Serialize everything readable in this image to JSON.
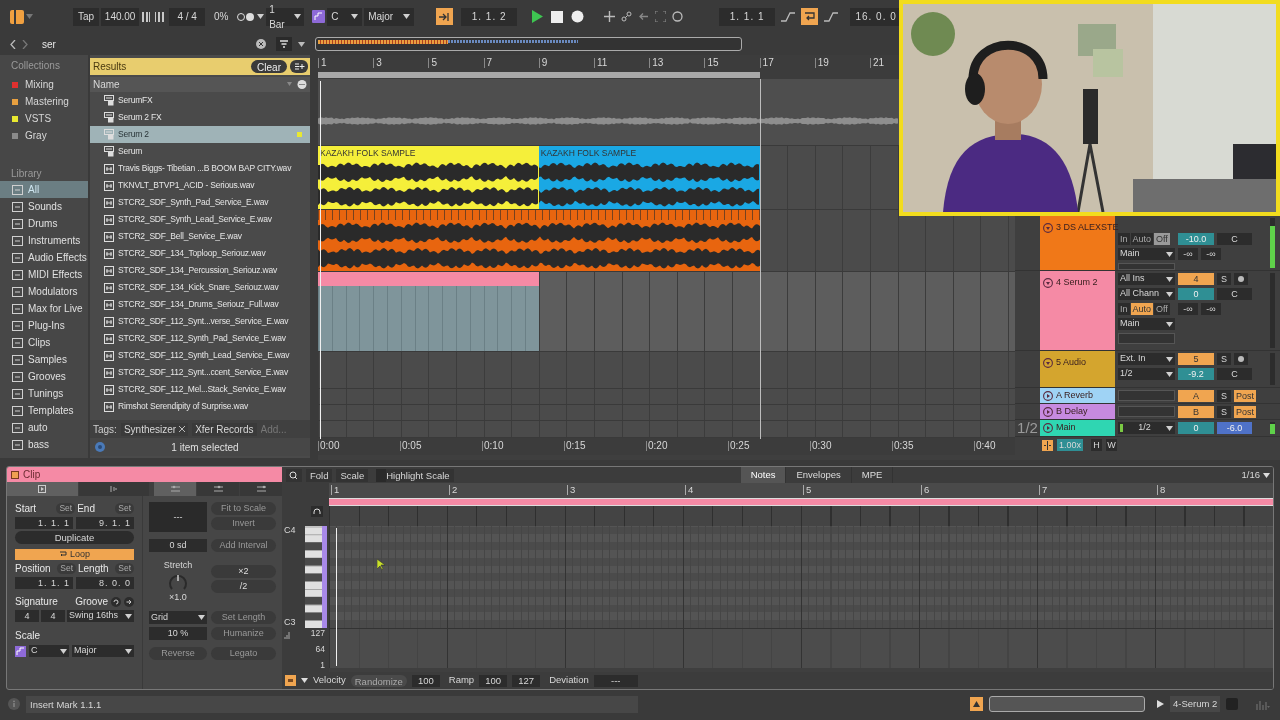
{
  "transport": {
    "tap": "Tap",
    "tempo": "140.00",
    "signature": "4 / 4",
    "cpu": "0%",
    "quantize": "1 Bar",
    "key": "C",
    "scale": "Major",
    "follow": true,
    "position": "1. 1. 2",
    "playing": true,
    "loop_start": "1. 1. 1",
    "loop": true,
    "loop_length": "16. 0. 0"
  },
  "browser": {
    "search": "ser",
    "collections_title": "Collections",
    "collections": [
      {
        "label": "Mixing",
        "color": "#e0302f"
      },
      {
        "label": "Mastering",
        "color": "#e8a040"
      },
      {
        "label": "VSTS",
        "color": "#e8e830"
      },
      {
        "label": "Gray",
        "color": "#8a8a8a"
      }
    ],
    "library_title": "Library",
    "library": [
      {
        "label": "All",
        "selected": true
      },
      {
        "label": "Sounds",
        "selected": false
      },
      {
        "label": "Drums",
        "selected": false
      },
      {
        "label": "Instruments",
        "selected": false
      },
      {
        "label": "Audio Effects",
        "selected": false
      },
      {
        "label": "MIDI Effects",
        "selected": false
      },
      {
        "label": "Modulators",
        "selected": false
      },
      {
        "label": "Max for Live",
        "selected": false
      },
      {
        "label": "Plug-Ins",
        "selected": false
      },
      {
        "label": "Clips",
        "selected": false
      },
      {
        "label": "Samples",
        "selected": false
      },
      {
        "label": "Grooves",
        "selected": false
      },
      {
        "label": "Tunings",
        "selected": false
      },
      {
        "label": "Templates",
        "selected": false
      },
      {
        "label": "auto",
        "selected": false
      },
      {
        "label": "bass",
        "selected": false
      }
    ],
    "results_title": "Results",
    "clear": "Clear",
    "column": "Name",
    "results": [
      {
        "name": "SerumFX",
        "kind": "plugin",
        "selected": false
      },
      {
        "name": "Serum 2 FX",
        "kind": "plugin",
        "selected": false
      },
      {
        "name": "Serum 2",
        "kind": "plugin",
        "selected": true,
        "color": "#e8e830"
      },
      {
        "name": "Serum",
        "kind": "plugin",
        "selected": false
      },
      {
        "name": "Travis Biggs- Tibetian ...B BOOM BAP CITY.wav",
        "kind": "audio",
        "selected": false
      },
      {
        "name": "TKNVLT_BTVP1_ACID - Serious.wav",
        "kind": "audio",
        "selected": false
      },
      {
        "name": "STCR2_SDF_Synth_Pad_Service_E.wav",
        "kind": "audio",
        "selected": false
      },
      {
        "name": "STCR2_SDF_Synth_Lead_Service_E.wav",
        "kind": "audio",
        "selected": false
      },
      {
        "name": "STCR2_SDF_Bell_Service_E.wav",
        "kind": "audio",
        "selected": false
      },
      {
        "name": "STCR2_SDF_134_Toploop_Seriouz.wav",
        "kind": "audio",
        "selected": false
      },
      {
        "name": "STCR2_SDF_134_Percussion_Seriouz.wav",
        "kind": "audio",
        "selected": false
      },
      {
        "name": "STCR2_SDF_134_Kick_Snare_Seriouz.wav",
        "kind": "audio",
        "selected": false
      },
      {
        "name": "STCR2_SDF_134_Drums_Seriouz_Full.wav",
        "kind": "audio",
        "selected": false
      },
      {
        "name": "STCR2_SDF_112_Synt...verse_Service_E.wav",
        "kind": "audio",
        "selected": false
      },
      {
        "name": "STCR2_SDF_112_Synth_Pad_Service_E.wav",
        "kind": "audio",
        "selected": false
      },
      {
        "name": "STCR2_SDF_112_Synth_Lead_Service_E.wav",
        "kind": "audio",
        "selected": false
      },
      {
        "name": "STCR2_SDF_112_Synt...ccent_Service_E.wav",
        "kind": "audio",
        "selected": false
      },
      {
        "name": "STCR2_SDF_112_Mel...Stack_Service_E.wav",
        "kind": "audio",
        "selected": false
      },
      {
        "name": "Rimshot Serendipity of Surprise.wav",
        "kind": "audio",
        "selected": false
      }
    ],
    "tags_label": "Tags:",
    "tags": [
      "Synthesizer",
      "Xfer Records"
    ],
    "tags_placeholder": "Add...",
    "status": "1 item selected"
  },
  "arrangement": {
    "bars": [
      "1",
      "3",
      "5",
      "7",
      "9",
      "11",
      "13",
      "15",
      "17",
      "19",
      "21"
    ],
    "times": [
      "0:00",
      "0:05",
      "0:10",
      "0:15",
      "0:20",
      "0:25",
      "0:30",
      "0:35",
      "0:40"
    ],
    "lanes": [
      {
        "clips": [
          {
            "kind": "audio",
            "color": "#4e4e4e"
          }
        ]
      },
      {
        "clips": [
          {
            "kind": "audio",
            "name": "KAZAKH FOLK SAMPLE",
            "color": "#f5ef3a"
          },
          {
            "kind": "audio",
            "name": "KAZAKH FOLK SAMPLE",
            "color": "#1aa8e4"
          }
        ]
      },
      {
        "clips": [
          {
            "kind": "audio",
            "color": "#e8650f"
          }
        ]
      },
      {
        "clips": [
          {
            "kind": "midi",
            "color": "#f58aa5"
          }
        ]
      }
    ]
  },
  "mixer": {
    "tracks": [
      {
        "kind": "audio",
        "name": "3 DS ALEXSTE",
        "color": "#f07818",
        "selected": false,
        "monitor": [
          {
            "label": "In",
            "selected": false
          },
          {
            "label": "Auto",
            "selected": false
          },
          {
            "label": "Off",
            "selected": true
          }
        ],
        "output": "Main",
        "volume": "-10.0",
        "pan": "C",
        "sends": [
          "-∞",
          "-∞"
        ],
        "level": 0.85
      },
      {
        "kind": "midi",
        "name": "4 Serum 2",
        "color": "#f58aa5",
        "selected": true,
        "input": "All Ins",
        "input_channel": "All Chann",
        "monitor": [
          {
            "label": "In",
            "selected": false
          },
          {
            "label": "Auto",
            "selected": true
          },
          {
            "label": "Off",
            "selected": false
          }
        ],
        "output": "Main",
        "number": "4",
        "solo": "S",
        "volume": "0",
        "pan": "C",
        "sends": [
          "-∞",
          "-∞"
        ]
      },
      {
        "kind": "audio",
        "name": "5 Audio",
        "color": "#d4a52e",
        "selected": false,
        "input": "Ext. In",
        "input_channel": "1/2",
        "number": "5",
        "solo": "S",
        "volume": "-9.2",
        "pan": "C"
      },
      {
        "kind": "return",
        "name": "A Reverb",
        "color": "#9fd3f5",
        "selected": false,
        "number": "A",
        "solo": "S",
        "post": "Post"
      },
      {
        "kind": "return",
        "name": "B Delay",
        "color": "#c78ae0",
        "selected": false,
        "number": "B",
        "solo": "S",
        "post": "Post"
      },
      {
        "kind": "main",
        "name": "Main",
        "color": "#2fd6b2",
        "selected": false,
        "output": "1/2",
        "volume": "0",
        "cue": "-6.0",
        "level": 0.8
      }
    ],
    "sends_label": "1/2",
    "zoom": "1.00x",
    "h": "H",
    "w": "W"
  },
  "clip": {
    "title": "Clip",
    "tabs": [
      {
        "selected": true
      },
      {
        "selected": false
      }
    ],
    "transform_tabs": [
      {
        "selected": true
      },
      {
        "selected": false
      },
      {
        "selected": false
      }
    ],
    "start": {
      "label": "Start",
      "set": "Set",
      "value": "1. 1. 1"
    },
    "end": {
      "label": "End",
      "set": "Set",
      "value": "9. 1. 1"
    },
    "duplicate": "Duplicate",
    "loop": {
      "label": "Loop",
      "on": true
    },
    "position": {
      "label": "Position",
      "set": "Set",
      "value": "1. 1. 1"
    },
    "length": {
      "label": "Length",
      "set": "Set",
      "value": "8. 0. 0"
    },
    "signature_label": "Signature",
    "numerator": "4",
    "denominator": "4",
    "groove_label": "Groove",
    "groove": "Swing 16ths",
    "scale_label": "Scale",
    "scale_key": "C",
    "scale_mode": "Major",
    "display": "---",
    "fit_to_scale": "Fit to Scale",
    "invert": "Invert",
    "interval": "0 sd",
    "add_interval": "Add Interval",
    "stretch": "Stretch",
    "stretch_value": "×1.0",
    "double": "×2",
    "half": "/2",
    "grid": "Grid",
    "set_length": "Set Length",
    "humanize_amount": "10 %",
    "humanize": "Humanize",
    "reverse": "Reverse",
    "legato": "Legato"
  },
  "editor": {
    "fold": "Fold",
    "scale": "Scale",
    "highlight_scale": "Highlight Scale",
    "tabs": [
      {
        "label": "Notes",
        "selected": true
      },
      {
        "label": "Envelopes",
        "selected": false
      },
      {
        "label": "MPE",
        "selected": false
      }
    ],
    "grid": "1/16",
    "bars": [
      "1",
      "2",
      "3",
      "4",
      "5",
      "6",
      "7",
      "8"
    ],
    "keys": [
      "C4",
      "C3"
    ],
    "velocity_ticks": [
      "127",
      "64",
      "1"
    ],
    "velocity": "Velocity",
    "randomize": "Randomize",
    "velocity_value": "100",
    "ramp": "Ramp",
    "ramp_start": "100",
    "ramp_end": "127",
    "deviation": "Deviation",
    "deviation_value": "---"
  },
  "status": {
    "message": "Insert Mark 1.1.1",
    "track": "4-Serum 2"
  }
}
